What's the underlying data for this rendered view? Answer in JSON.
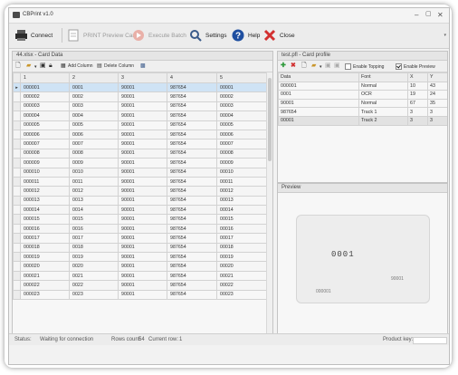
{
  "app": {
    "title": "CBPrint v1.0"
  },
  "toolbar": {
    "connect_label": "Connect",
    "print_preview_label": "PRINT Preview Card",
    "execute_label": "Execute Batch",
    "settings_label": "Settings",
    "help_label": "Help",
    "close_label": "Close"
  },
  "card_data": {
    "header": "44.xlsx - Card Data",
    "add_columns_label": "Add Column",
    "delete_columns_label": "Delete Column",
    "columns": [
      "1",
      "2",
      "3",
      "4",
      "5"
    ],
    "rows": [
      [
        "000001",
        "0001",
        "90001",
        "987654",
        "00001"
      ],
      [
        "000002",
        "0002",
        "90001",
        "987654",
        "00002"
      ],
      [
        "000003",
        "0003",
        "90001",
        "987654",
        "00003"
      ],
      [
        "000004",
        "0004",
        "90001",
        "987654",
        "00004"
      ],
      [
        "000005",
        "0005",
        "90001",
        "987654",
        "00005"
      ],
      [
        "000006",
        "0006",
        "90001",
        "987654",
        "00006"
      ],
      [
        "000007",
        "0007",
        "90001",
        "987654",
        "00007"
      ],
      [
        "000008",
        "0008",
        "90001",
        "987654",
        "00008"
      ],
      [
        "000009",
        "0009",
        "90001",
        "987654",
        "00009"
      ],
      [
        "000010",
        "0010",
        "90001",
        "987654",
        "00010"
      ],
      [
        "000011",
        "0011",
        "90001",
        "987654",
        "00011"
      ],
      [
        "000012",
        "0012",
        "90001",
        "987654",
        "00012"
      ],
      [
        "000013",
        "0013",
        "90001",
        "987654",
        "00013"
      ],
      [
        "000014",
        "0014",
        "90001",
        "987654",
        "00014"
      ],
      [
        "000015",
        "0015",
        "90001",
        "987654",
        "00015"
      ],
      [
        "000016",
        "0016",
        "90001",
        "987654",
        "00016"
      ],
      [
        "000017",
        "0017",
        "90001",
        "987654",
        "00017"
      ],
      [
        "000018",
        "0018",
        "90001",
        "987654",
        "00018"
      ],
      [
        "000019",
        "0019",
        "90001",
        "987654",
        "00019"
      ],
      [
        "000020",
        "0020",
        "90001",
        "987654",
        "00020"
      ],
      [
        "000021",
        "0021",
        "90001",
        "987654",
        "00021"
      ],
      [
        "000022",
        "0022",
        "90001",
        "987654",
        "00022"
      ],
      [
        "000023",
        "0023",
        "90001",
        "987654",
        "00023"
      ]
    ]
  },
  "card_profile": {
    "header": "test.pfl - Card profile",
    "enable_topping_label": "Enable Topping",
    "enable_preview_label": "Enable Preview",
    "enable_topping": false,
    "enable_preview": true,
    "columns": [
      "Data",
      "Font",
      "X",
      "Y"
    ],
    "rows": [
      [
        "000001",
        "Normal",
        "10",
        "43"
      ],
      [
        "0001",
        "OCR",
        "19",
        "24"
      ],
      [
        "90001",
        "Normal",
        "67",
        "35"
      ],
      [
        "987654",
        "Track 1",
        "3",
        "3"
      ],
      [
        "00001",
        "Track 2",
        "3",
        "3"
      ]
    ]
  },
  "preview": {
    "header": "Preview",
    "big_text": "0001",
    "small_right": "90001",
    "small_left": "000001"
  },
  "status": {
    "label": "Status:",
    "text": "Waiting for connection",
    "rows_label": "Rows count:",
    "rows_value": "54",
    "current_label": "Current row:",
    "current_value": "1",
    "product_key_label": "Product key:"
  },
  "colors": {
    "close_icon": "#d23030",
    "help_icon": "#1f4fa0",
    "selection": "#cfe3f5",
    "add_icon": "#2e9a3a",
    "delete_icon": "#d23030"
  }
}
